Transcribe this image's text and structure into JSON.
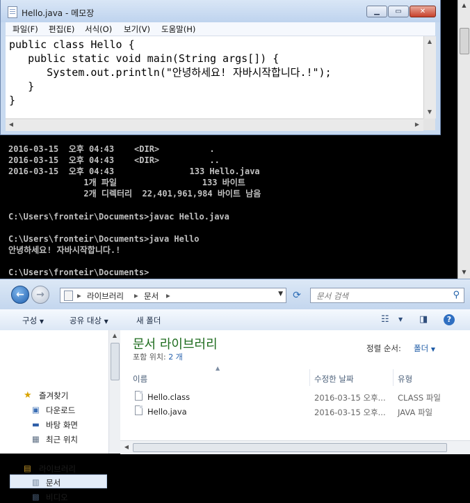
{
  "notepad": {
    "title": "Hello.java - 메모장",
    "menu": [
      "파일(F)",
      "편집(E)",
      "서식(O)",
      "보기(V)",
      "도움말(H)"
    ],
    "content": "public class Hello {\n   public static void main(String args[]) {\n      System.out.println(\"안녕하세요! 자바시작합니다.!\");\n   }\n}"
  },
  "console": {
    "lines": [
      "2016-03-15  오후 04:43    <DIR>          .",
      "2016-03-15  오후 04:43    <DIR>          ..",
      "2016-03-15  오후 04:43               133 Hello.java",
      "               1개 파일                 133 바이트",
      "               2개 디렉터리  22,401,961,984 바이트 남음",
      "",
      "C:\\Users\\fronteir\\Documents>javac Hello.java",
      "",
      "C:\\Users\\fronteir\\Documents>java Hello",
      "안녕하세요! 자바시작합니다.!",
      "",
      "C:\\Users\\fronteir\\Documents>"
    ]
  },
  "explorer": {
    "address": [
      "라이브러리",
      "문서"
    ],
    "search_placeholder": "문서 검색",
    "toolbar": {
      "organize": "구성",
      "share": "공유 대상",
      "new_folder": "새 폴더"
    },
    "nav": {
      "favorites": "즐겨찾기",
      "favorites_items": [
        "다운로드",
        "바탕 화면",
        "최근 위치"
      ],
      "libraries": "라이브러리",
      "libraries_items": [
        "문서",
        "비디오"
      ]
    },
    "library": {
      "title": "문서 라이브러리",
      "includes_label": "포함 위치:",
      "includes_count": "2 개",
      "sort_label": "정렬 순서:",
      "sort_value": "폴더"
    },
    "columns": [
      "이름",
      "수정한 날짜",
      "유형"
    ],
    "files": [
      {
        "name": "Hello.class",
        "date": "2016-03-15 오후...",
        "type": "CLASS 파일"
      },
      {
        "name": "Hello.java",
        "date": "2016-03-15 오후...",
        "type": "JAVA 파일"
      }
    ]
  }
}
